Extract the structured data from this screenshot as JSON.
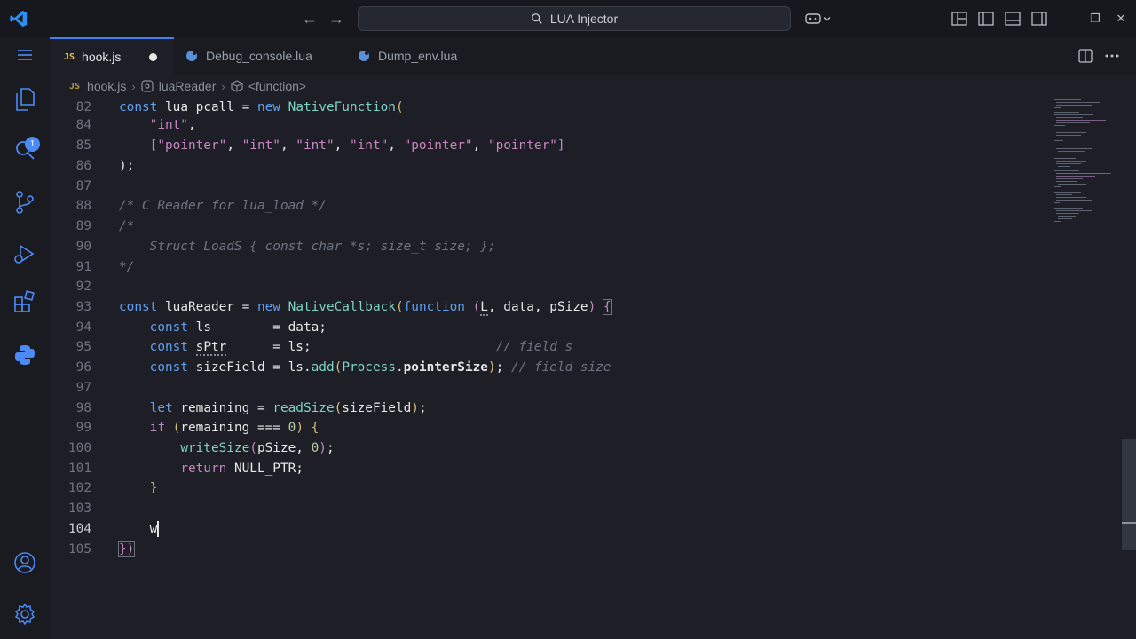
{
  "titlebar": {
    "search_text": "LUA Injector",
    "icons": [
      "vscode-logo-icon",
      "arrow-left-icon",
      "arrow-right-icon",
      "search-icon",
      "copilot-icon",
      "chevron-down-icon",
      "layout-icon",
      "toggle-primary-sidebar-icon",
      "toggle-panel-icon",
      "toggle-secondary-sidebar-icon",
      "minimize-icon",
      "restore-icon",
      "close-icon"
    ],
    "window": {
      "minimize": "—",
      "restore": "❐",
      "close": "✕"
    }
  },
  "activity_bar": {
    "items": [
      "menu-icon",
      "explorer-icon",
      "search-icon",
      "source-control-icon",
      "run-debug-icon",
      "extensions-icon",
      "python-icon",
      "accounts-icon",
      "settings-icon"
    ],
    "explorer_badge": "1"
  },
  "tabs": [
    {
      "label": "hook.js",
      "icon": "js-icon",
      "badge": "JS",
      "active": true,
      "modified": true
    },
    {
      "label": "Debug_console.lua",
      "icon": "lua-icon",
      "active": false
    },
    {
      "label": "Dump_env.lua",
      "icon": "lua-icon",
      "active": false
    }
  ],
  "breadcrumb": {
    "file_badge": "JS",
    "file": "hook.js",
    "symbol": "luaReader",
    "scope": "<function>"
  },
  "editor": {
    "current_line": "104",
    "lines": [
      {
        "n": "82"
      },
      {
        "n": "84"
      },
      {
        "n": "85"
      },
      {
        "n": "86"
      },
      {
        "n": "87"
      },
      {
        "n": "88"
      },
      {
        "n": "89"
      },
      {
        "n": "90"
      },
      {
        "n": "91"
      },
      {
        "n": "92"
      },
      {
        "n": "93"
      },
      {
        "n": "94"
      },
      {
        "n": "95"
      },
      {
        "n": "96"
      },
      {
        "n": "97"
      },
      {
        "n": "98"
      },
      {
        "n": "99"
      },
      {
        "n": "100"
      },
      {
        "n": "101"
      },
      {
        "n": "102"
      },
      {
        "n": "103"
      },
      {
        "n": "104"
      },
      {
        "n": "105"
      }
    ],
    "code": {
      "l82": {
        "kw": "const",
        "name": "lua_pcall",
        "op": " = ",
        "new": "new",
        "cls": "NativeFunction",
        "tail": "("
      },
      "l84": {
        "str": "\"int\"",
        "tail": ","
      },
      "l85": {
        "strs": [
          "\"pointer\"",
          "\"int\"",
          "\"int\"",
          "\"int\"",
          "\"pointer\"",
          "\"pointer\""
        ]
      },
      "l86": {
        "text": ");"
      },
      "l88": {
        "comment": "/* C Reader for lua_load */"
      },
      "l89": {
        "comment": "/*"
      },
      "l90": {
        "comment": "    Struct LoadS { const char *s; size_t size; };"
      },
      "l91": {
        "comment": "*/"
      },
      "l93": {
        "kw": "const",
        "name": "luaReader",
        "op": " = ",
        "new": "new",
        "cls": "NativeCallback",
        "fnkw": "function",
        "params": [
          "L",
          "data",
          "pSize"
        ]
      },
      "l94": {
        "kw": "const",
        "name": "ls",
        "pad": "        = ",
        "value": "data",
        "tail": ";"
      },
      "l95": {
        "kw": "const",
        "name": "sPtr",
        "pad": "      = ",
        "value": "ls",
        "tail": ";",
        "comment": "// field s"
      },
      "l96": {
        "kw": "const",
        "name": "sizeField",
        "op": " = ",
        "obj": "ls",
        "method": "add",
        "arg_obj": "Process",
        "arg_prop": "pointerSize",
        "comment": "// field size"
      },
      "l98": {
        "kw": "let",
        "name": "remaining",
        "op": " = ",
        "fn": "readSize",
        "arg": "sizeField"
      },
      "l99": {
        "kw": "if",
        "var": "remaining",
        "op": " === ",
        "num": "0"
      },
      "l100": {
        "fn": "writeSize",
        "arg": "pSize",
        "num": "0"
      },
      "l101": {
        "kw": "return",
        "value": "NULL_PTR"
      },
      "l102": {
        "text": "}"
      },
      "l104": {
        "typed": "w"
      },
      "l105": {
        "text": "})"
      }
    }
  }
}
